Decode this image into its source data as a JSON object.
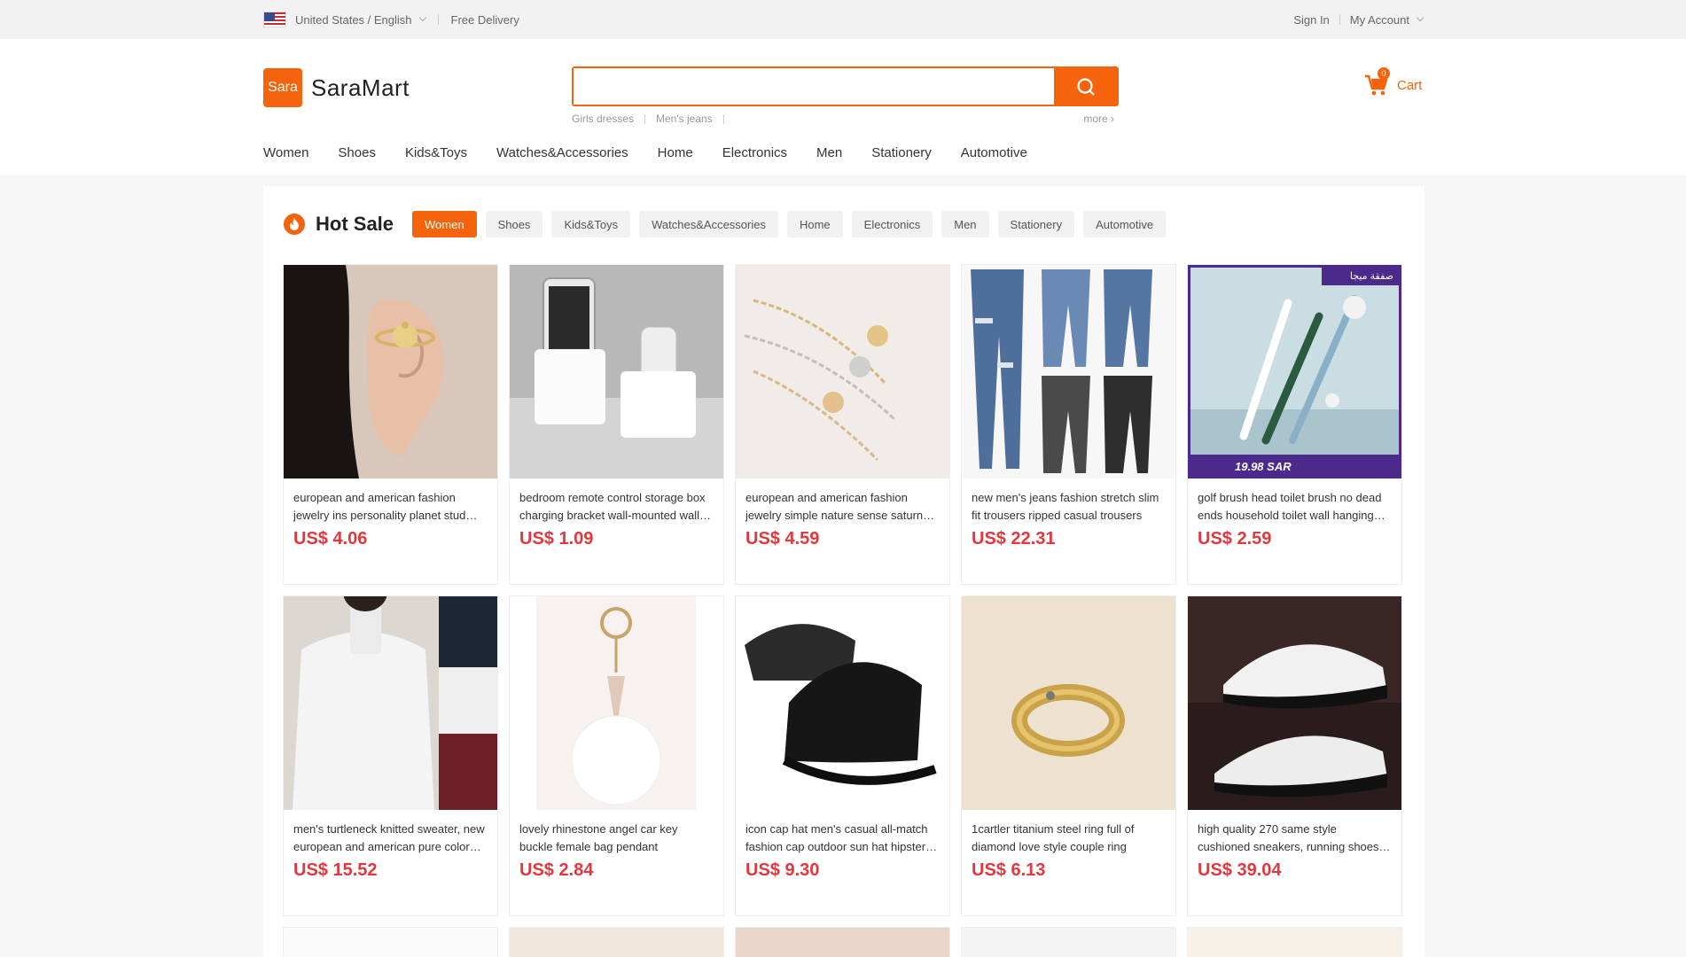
{
  "topbar": {
    "region": "United States / English",
    "delivery": "Free Delivery",
    "sign_in": "Sign In",
    "account": "My Account"
  },
  "header": {
    "logo_mark": "Sara",
    "logo_name": "SaraMart",
    "search_placeholder": "",
    "hot_words": [
      "Girls dresses",
      "Men's jeans"
    ],
    "more": "more ›",
    "cart_label": "Cart",
    "cart_count": "0"
  },
  "categories": [
    "Women",
    "Shoes",
    "Kids&Toys",
    "Watches&Accessories",
    "Home",
    "Electronics",
    "Men",
    "Stationery",
    "Automotive"
  ],
  "hot_sale": {
    "title": "Hot Sale",
    "tabs": [
      "Women",
      "Shoes",
      "Kids&Toys",
      "Watches&Accessories",
      "Home",
      "Electronics",
      "Men",
      "Stationery",
      "Automotive"
    ],
    "active_tab": "Women"
  },
  "products": [
    {
      "title": "european and american fashion jewelry ins personality planet stud earrings",
      "price": "US$ 4.06",
      "image": "planet-earring"
    },
    {
      "title": "bedroom remote control storage box charging bracket wall-mounted wall holder",
      "price": "US$ 1.09",
      "image": "phone-remote-holder"
    },
    {
      "title": "european and american fashion jewelry simple nature sense saturn bracelet",
      "price": "US$ 4.59",
      "image": "saturn-bracelets"
    },
    {
      "title": "new men's jeans fashion stretch slim fit trousers ripped casual trousers",
      "price": "US$ 22.31",
      "image": "ripped-jeans"
    },
    {
      "title": "golf brush head toilet brush no dead ends household toilet wall hanging brush",
      "price": "US$ 2.59",
      "image": "golf-toilet-brush",
      "badge": "صفقة ميجا",
      "promo_price": "19.98 SAR"
    },
    {
      "title": "men's turtleneck knitted sweater, new european and american pure color sweater",
      "price": "US$ 15.52",
      "image": "turtleneck-sweater"
    },
    {
      "title": "lovely rhinestone angel car key buckle female bag pendant",
      "price": "US$ 2.84",
      "image": "pompom-keychain"
    },
    {
      "title": "icon cap hat men's casual all-match fashion cap outdoor sun hat hipster cap",
      "price": "US$ 9.30",
      "image": "black-cap"
    },
    {
      "title": "1cartler titanium steel ring full of diamond love style couple ring",
      "price": "US$ 6.13",
      "image": "gold-ring"
    },
    {
      "title": "high quality 270 same style cushioned sneakers, running shoes for men",
      "price": "US$ 39.04",
      "image": "sneakers"
    }
  ],
  "colors": {
    "accent": "#f5640c",
    "price": "#e3373e"
  }
}
